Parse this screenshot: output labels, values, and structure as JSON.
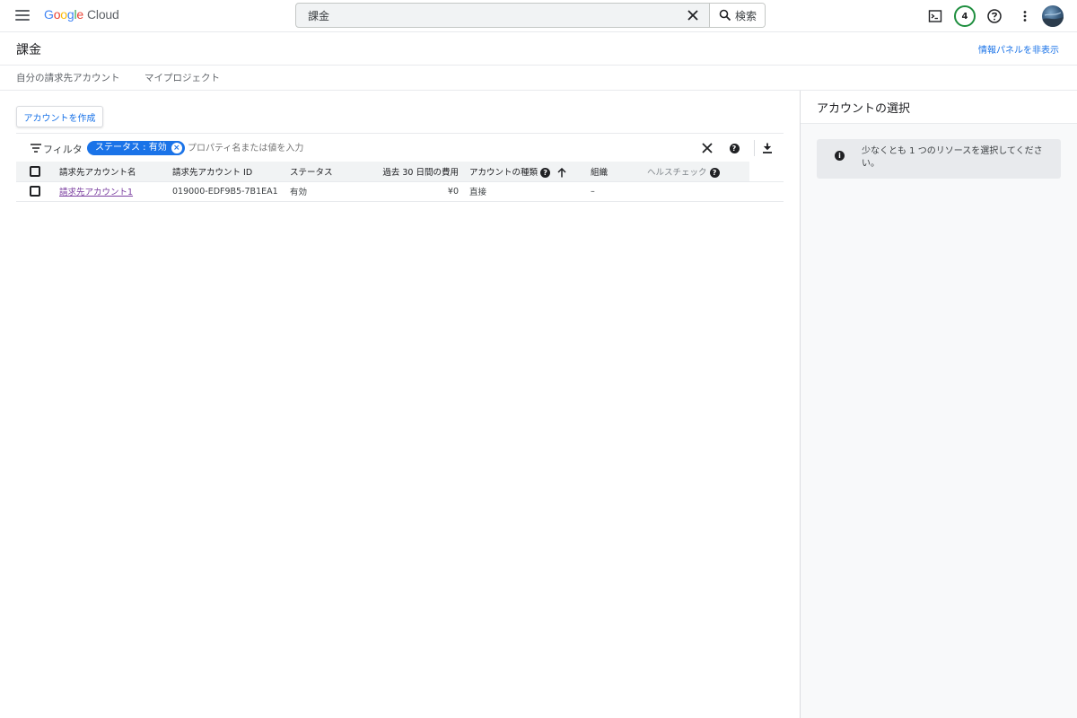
{
  "header": {
    "logo_google": [
      "G",
      "o",
      "o",
      "g",
      "l",
      "e"
    ],
    "logo_cloud": "Cloud",
    "search_value": "課金",
    "search_button": "検索",
    "notifications_count": "4"
  },
  "page": {
    "title": "課金",
    "hide_panel_link": "情報パネルを非表示"
  },
  "tabs": [
    {
      "label": "自分の請求先アカウント"
    },
    {
      "label": "マイプロジェクト"
    }
  ],
  "toolbar": {
    "create_button": "アカウントを作成",
    "filter_label": "フィルタ",
    "filter_chip": "ステータス : 有効",
    "filter_placeholder": "プロパティ名または値を入力"
  },
  "table": {
    "headers": {
      "name": "請求先アカウント名",
      "id": "請求先アカウント ID",
      "status": "ステータス",
      "cost": "過去 30 日間の費用",
      "type": "アカウントの種類",
      "org": "組織",
      "health": "ヘルスチェック"
    },
    "rows": [
      {
        "name": "請求先アカウント1",
        "id": "019000-EDF9B5-7B1EA1",
        "status": "有効",
        "cost": "¥0",
        "type": "直接",
        "org": "–",
        "health": ""
      }
    ]
  },
  "panel": {
    "title": "アカウントの選択",
    "info_text": "少なくとも 1 つのリソースを選択してください。"
  },
  "colors": {
    "accent": "#1a73e8",
    "link_visited": "#7b3fa0",
    "badge_ring": "#1e8e3e"
  }
}
